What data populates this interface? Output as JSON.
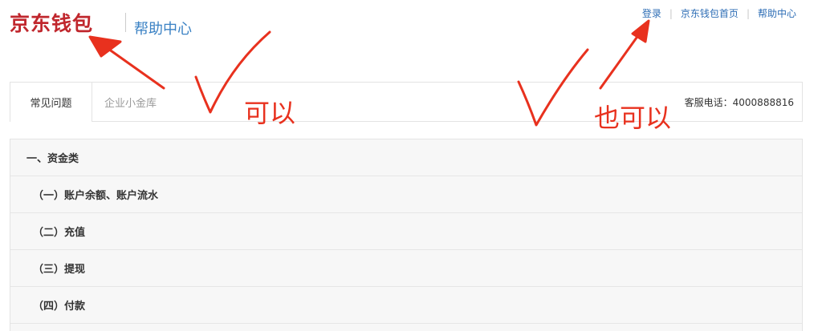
{
  "header": {
    "brand": "京东钱包",
    "help_title": "帮助中心",
    "nav": [
      {
        "label": "登录"
      },
      {
        "label": "京东钱包首页"
      },
      {
        "label": "帮助中心"
      }
    ]
  },
  "tabs": [
    {
      "label": "常见问题",
      "active": true
    },
    {
      "label": "企业小金库",
      "active": false
    }
  ],
  "hotline": "客服电话：4000888816",
  "list": {
    "category": "一、资金类",
    "items": [
      {
        "label": "（一）账户余额、账户流水"
      },
      {
        "label": "（二）充值"
      },
      {
        "label": "（三）提现"
      },
      {
        "label": "（四）付款"
      }
    ]
  },
  "annotations": {
    "color": "#e8311e",
    "left_text": "可以",
    "right_text": "也可以"
  },
  "colors": {
    "brand": "#c0272d",
    "link": "#2d6db5",
    "help_title": "#3b82c4"
  }
}
